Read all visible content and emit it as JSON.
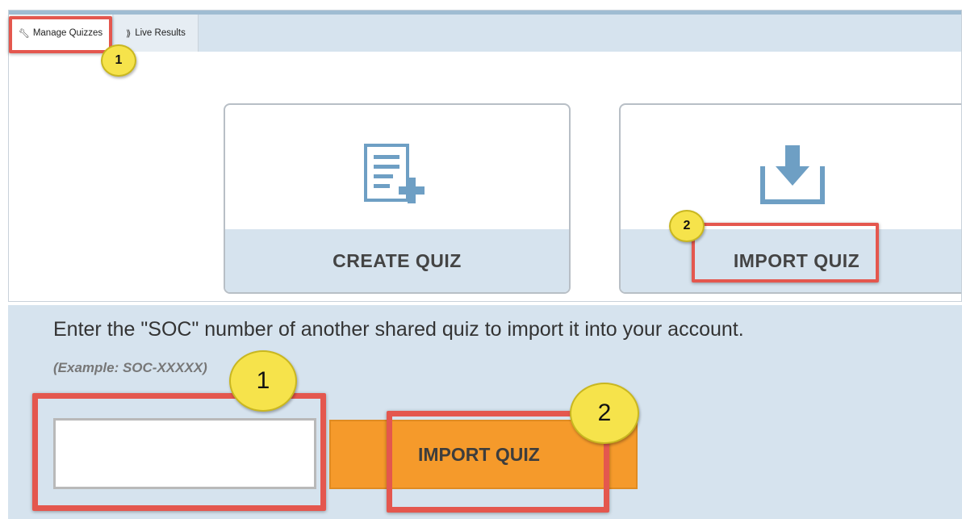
{
  "tabs": {
    "manage_label": "Manage Quizzes",
    "live_label": "Live Results"
  },
  "cards": {
    "create_label": "CREATE QUIZ",
    "import_label": "IMPORT QUIZ"
  },
  "import_form": {
    "instruction": "Enter the \"SOC\" number of another shared quiz to import it into your account.",
    "example": "(Example: SOC-XXXXX)",
    "input_value": "",
    "button_label": "IMPORT QUIZ"
  },
  "annotations": {
    "top_step_1": "1",
    "top_step_2": "2",
    "bottom_step_1": "1",
    "bottom_step_2": "2"
  },
  "icons": {
    "wrench": "wrench-icon",
    "live": "live-results-icon",
    "create": "create-quiz-icon",
    "import": "import-download-icon"
  },
  "colors": {
    "accent_blue": "#6e9fc4",
    "panel_blue": "#d6e3ee",
    "import_orange": "#f59a2b",
    "highlight_red": "#e4574e",
    "callout_yellow": "#f6e34b"
  }
}
